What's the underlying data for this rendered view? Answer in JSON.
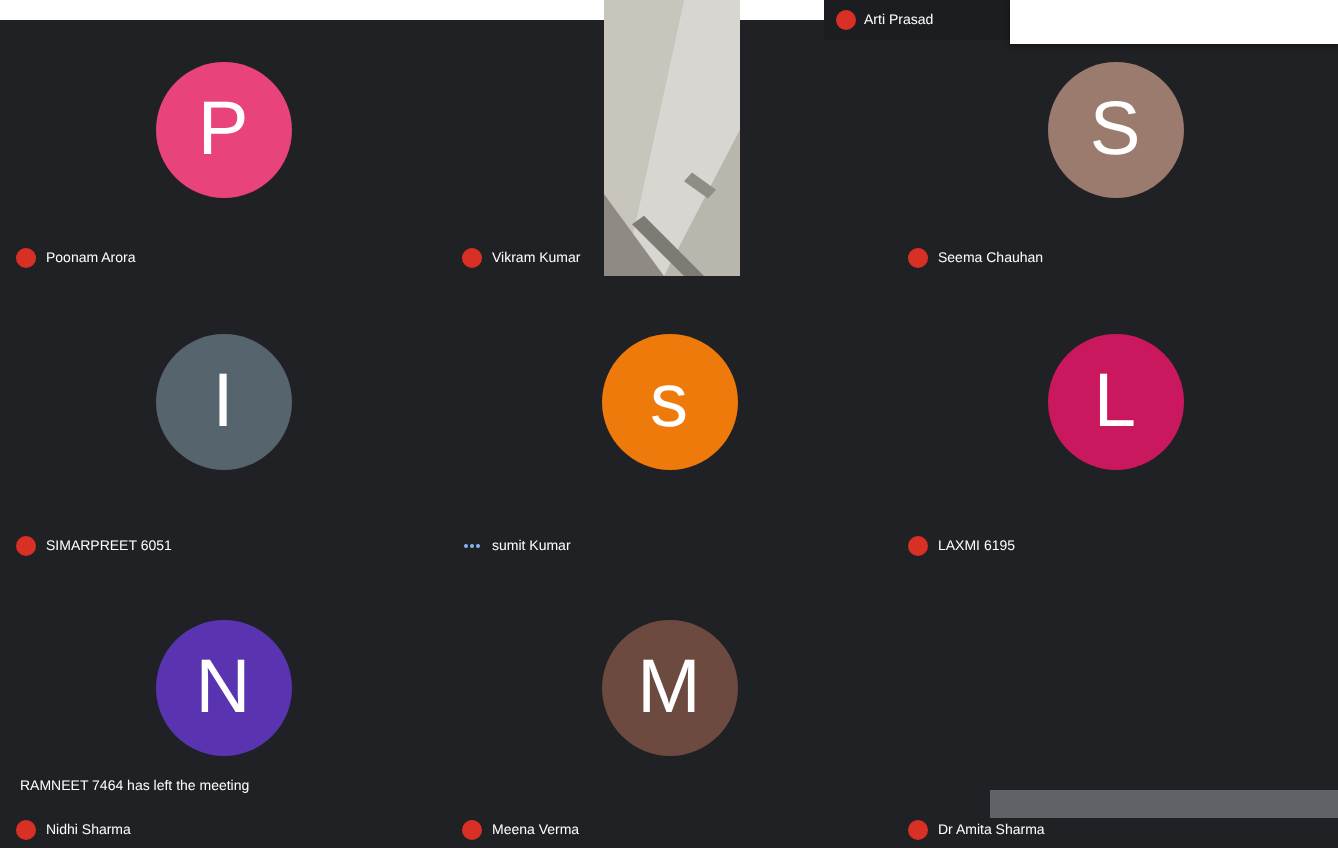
{
  "top_bar": {
    "name": "Arti Prasad",
    "mic_muted": true
  },
  "tiles": [
    {
      "kind": "avatar",
      "name": "Poonam Arora",
      "initial": "P",
      "color": "#e8437a",
      "mic_muted": true
    },
    {
      "kind": "video",
      "name": "Vikram Kumar",
      "mic_muted": true
    },
    {
      "kind": "avatar",
      "name": "Seema Chauhan",
      "initial": "S",
      "color": "#9b7b6e",
      "mic_muted": true
    },
    {
      "kind": "avatar",
      "name": "SIMARPREET 6051",
      "initial": "I",
      "color": "#56646e",
      "mic_muted": true
    },
    {
      "kind": "avatar",
      "name": "sumit Kumar",
      "initial": "s",
      "color": "#ef7a0c",
      "mic_muted": false
    },
    {
      "kind": "avatar",
      "name": "LAXMI 6195",
      "initial": "L",
      "color": "#c9185e",
      "mic_muted": true
    },
    {
      "kind": "avatar",
      "name": "Nidhi Sharma",
      "initial": "N",
      "color": "#5a34b0",
      "mic_muted": true
    },
    {
      "kind": "avatar",
      "name": "Meena Verma",
      "initial": "M",
      "color": "#6d4a3f",
      "mic_muted": true
    },
    {
      "kind": "blank",
      "name": "Dr Amita Sharma",
      "mic_muted": true
    }
  ],
  "toast": "RAMNEET 7464 has left the meeting"
}
